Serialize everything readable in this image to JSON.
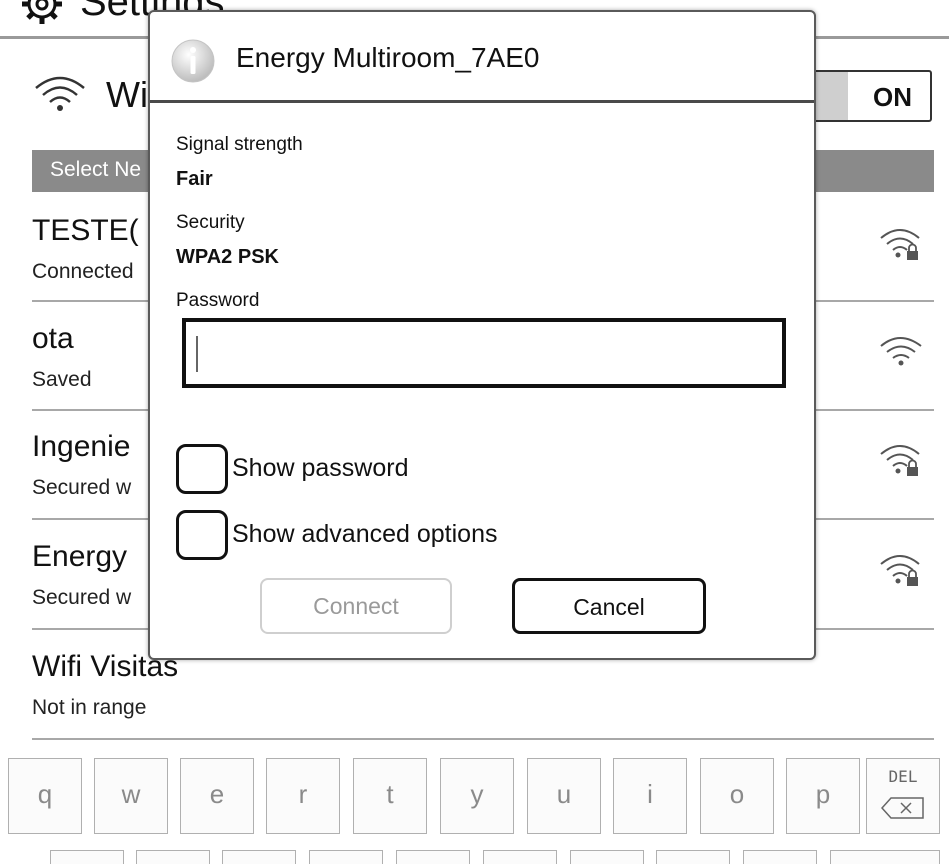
{
  "settings": {
    "title": "Settings",
    "wifi_label": "Wi",
    "toggle_label": "ON",
    "select_network_partial": "Select Ne"
  },
  "networks": [
    {
      "name": "TESTE(",
      "status": "Connected",
      "icon": "wifi-lock-icon"
    },
    {
      "name": "ota",
      "status": "Saved",
      "icon": "wifi-icon"
    },
    {
      "name": "Ingenie",
      "status": "Secured w",
      "icon": "wifi-lock-icon"
    },
    {
      "name": "Energy",
      "status": "Secured w",
      "icon": "wifi-lock-icon"
    },
    {
      "name": "Wifi Visitas",
      "status": "Not in range",
      "icon": "none"
    }
  ],
  "dialog": {
    "title": "Energy Multiroom_7AE0",
    "signal_label": "Signal strength",
    "signal_value": "Fair",
    "security_label": "Security",
    "security_value": "WPA2 PSK",
    "password_label": "Password",
    "password_value": "",
    "show_password_label": "Show password",
    "show_password_checked": false,
    "show_advanced_label": "Show advanced options",
    "show_advanced_checked": false,
    "connect_label": "Connect",
    "connect_enabled": false,
    "cancel_label": "Cancel"
  },
  "keyboard": {
    "keys": [
      "q",
      "w",
      "e",
      "r",
      "t",
      "y",
      "u",
      "i",
      "o",
      "p"
    ],
    "del_label": "DEL"
  },
  "colors": {
    "select_bar": "#8a8a8a",
    "divider": "#a8a8a8",
    "disabled_text": "#9a9a9a"
  }
}
